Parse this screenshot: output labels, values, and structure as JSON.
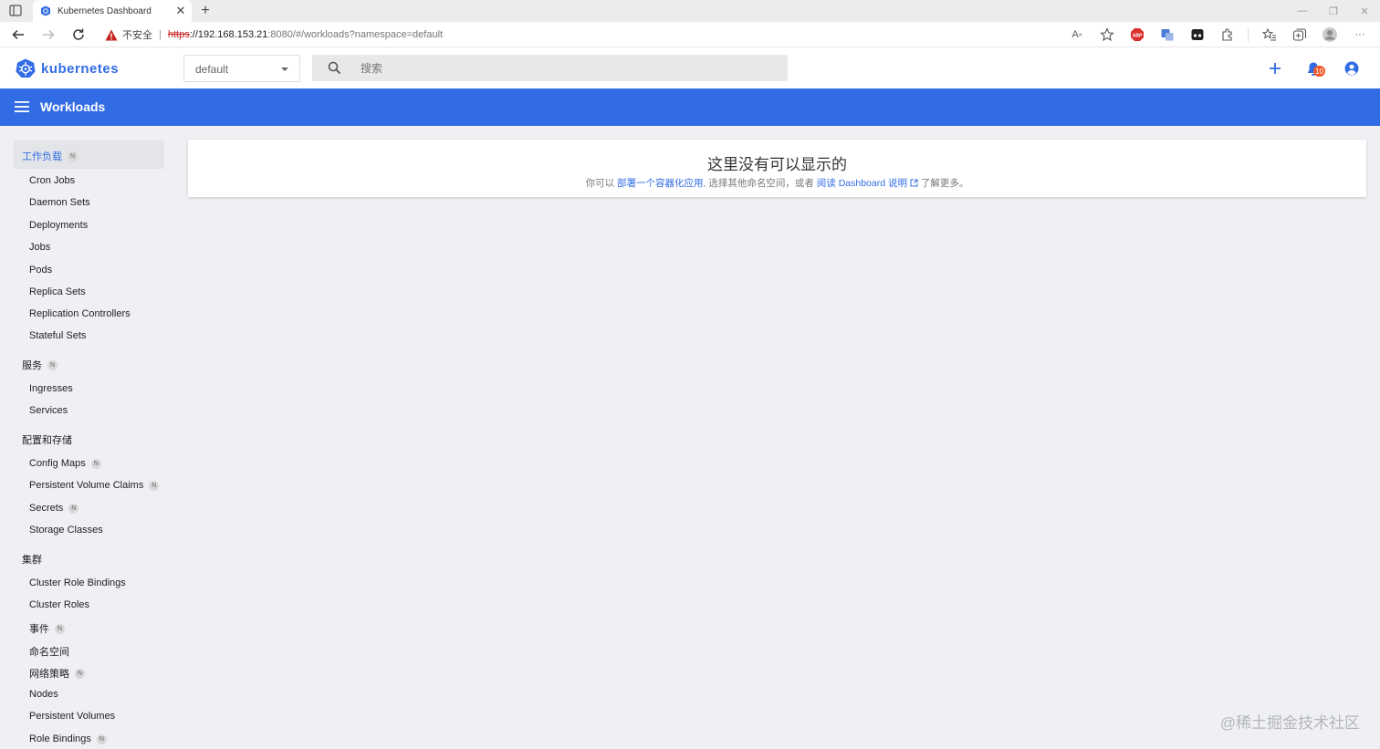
{
  "browser": {
    "tab_title": "Kubernetes Dashboard",
    "new_tab_symbol": "+",
    "security_label": "不安全",
    "url_scheme": "https",
    "url_host": "://192.168.153.21",
    "url_path": ":8080/#/workloads?namespace=default",
    "abp_label": "ABP"
  },
  "header": {
    "logo_text": "kubernetes",
    "namespace": "default",
    "search_placeholder": "搜索",
    "notification_count": "10"
  },
  "toolbar": {
    "title": "Workloads"
  },
  "sidebar": {
    "badge": "N",
    "groups": [
      {
        "label": "工作负载",
        "badge": true
      },
      {
        "label": "服务",
        "badge": true
      },
      {
        "label": "配置和存储",
        "badge": false
      },
      {
        "label": "集群",
        "badge": false
      }
    ],
    "workloads_items": [
      "Cron Jobs",
      "Daemon Sets",
      "Deployments",
      "Jobs",
      "Pods",
      "Replica Sets",
      "Replication Controllers",
      "Stateful Sets"
    ],
    "services_items": [
      "Ingresses",
      "Services"
    ],
    "config_items": [
      {
        "label": "Config Maps",
        "badge": true
      },
      {
        "label": "Persistent Volume Claims",
        "badge": true
      },
      {
        "label": "Secrets",
        "badge": true
      },
      {
        "label": "Storage Classes",
        "badge": false
      }
    ],
    "cluster_items": [
      {
        "label": "Cluster Role Bindings",
        "badge": false
      },
      {
        "label": "Cluster Roles",
        "badge": false
      },
      {
        "label": "事件",
        "badge": true
      },
      {
        "label": "命名空间",
        "badge": false
      },
      {
        "label": "网络策略",
        "badge": true
      },
      {
        "label": "Nodes",
        "badge": false
      },
      {
        "label": "Persistent Volumes",
        "badge": false
      },
      {
        "label": "Role Bindings",
        "badge": true
      }
    ]
  },
  "empty_state": {
    "title": "这里没有可以显示的",
    "desc_prefix": "你可以",
    "deploy_link": "部署一个容器化应用",
    "desc_middle": ", 选择其他命名空间，或者",
    "docs_link": "阅读 Dashboard 说明",
    "desc_suffix": "了解更多。"
  },
  "watermark": "@稀土掘金技术社区",
  "colors": {
    "brand": "#326ce5",
    "notification": "#f05a28"
  }
}
